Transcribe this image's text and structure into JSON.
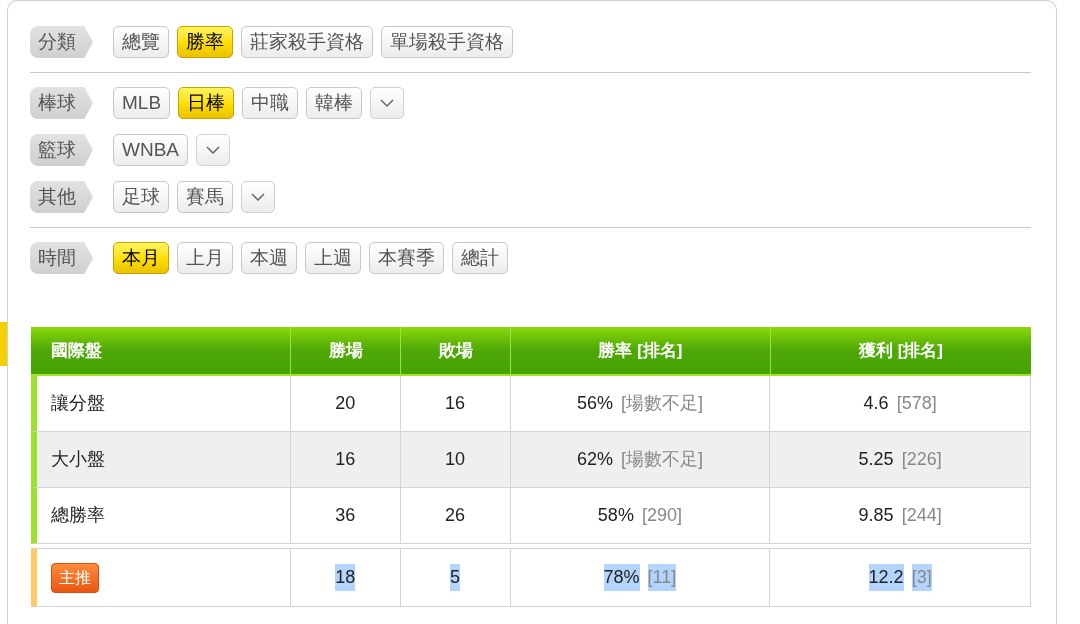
{
  "filter_sections": [
    {
      "rows": [
        {
          "label": "分類",
          "options": [
            {
              "label": "總覽",
              "selected": false
            },
            {
              "label": "勝率",
              "selected": true
            },
            {
              "label": "莊家殺手資格",
              "selected": false
            },
            {
              "label": "單場殺手資格",
              "selected": false
            }
          ],
          "dropdown": false
        }
      ]
    },
    {
      "rows": [
        {
          "label": "棒球",
          "options": [
            {
              "label": "MLB",
              "selected": false
            },
            {
              "label": "日棒",
              "selected": true
            },
            {
              "label": "中職",
              "selected": false
            },
            {
              "label": "韓棒",
              "selected": false
            }
          ],
          "dropdown": true
        },
        {
          "label": "籃球",
          "options": [
            {
              "label": "WNBA",
              "selected": false
            }
          ],
          "dropdown": true
        },
        {
          "label": "其他",
          "options": [
            {
              "label": "足球",
              "selected": false
            },
            {
              "label": "賽馬",
              "selected": false
            }
          ],
          "dropdown": true
        }
      ]
    },
    {
      "rows": [
        {
          "label": "時間",
          "options": [
            {
              "label": "本月",
              "selected": true
            },
            {
              "label": "上月",
              "selected": false
            },
            {
              "label": "本週",
              "selected": false
            },
            {
              "label": "上週",
              "selected": false
            },
            {
              "label": "本賽季",
              "selected": false
            },
            {
              "label": "總計",
              "selected": false
            }
          ],
          "dropdown": false
        }
      ]
    }
  ],
  "table": {
    "columns": [
      "國際盤",
      "勝場",
      "敗場",
      "勝率 [排名]",
      "獲利 [排名]"
    ],
    "rows": [
      {
        "kind": "normal",
        "name": "讓分盤",
        "wins": "20",
        "losses": "16",
        "rate": "56%",
        "rate_rank": "[場數不足]",
        "profit": "4.6",
        "profit_rank": "[578]",
        "text_highlighted": false
      },
      {
        "kind": "normal",
        "name": "大小盤",
        "wins": "16",
        "losses": "10",
        "rate": "62%",
        "rate_rank": "[場數不足]",
        "profit": "5.25",
        "profit_rank": "[226]",
        "text_highlighted": false
      },
      {
        "kind": "normal",
        "name": "總勝率",
        "wins": "36",
        "losses": "26",
        "rate": "58%",
        "rate_rank": "[290]",
        "profit": "9.85",
        "profit_rank": "[244]",
        "text_highlighted": false
      },
      {
        "kind": "featured",
        "name": "主推",
        "wins": "18",
        "losses": "5",
        "rate": "78%",
        "rate_rank": "[11]",
        "profit": "12.2",
        "profit_rank": "[3]",
        "text_highlighted": true
      }
    ]
  }
}
